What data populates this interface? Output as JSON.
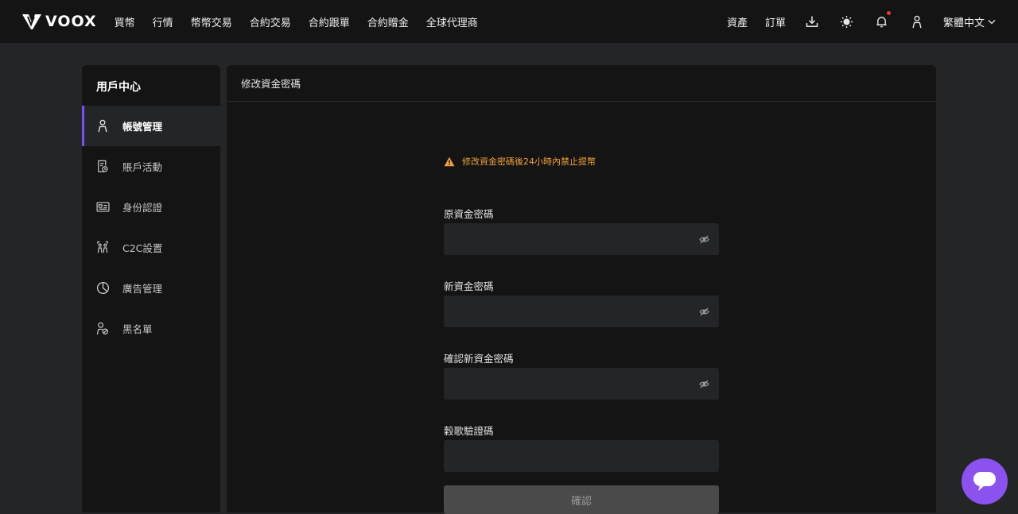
{
  "brand": {
    "name": "VOOX"
  },
  "nav": {
    "items": [
      "買幣",
      "行情",
      "幣幣交易",
      "合約交易",
      "合約跟單",
      "合約贈金",
      "全球代理商"
    ]
  },
  "header_right": {
    "assets": "資產",
    "orders": "訂單",
    "icons": [
      "download-icon",
      "theme-sun-icon",
      "bell-icon",
      "user-icon"
    ],
    "language": "繁體中文"
  },
  "sidebar": {
    "title": "用戶中心",
    "items": [
      {
        "label": "帳號管理",
        "icon": "user-icon",
        "active": true
      },
      {
        "label": "賬戶活動",
        "icon": "activity-icon",
        "active": false
      },
      {
        "label": "身份認證",
        "icon": "id-card-icon",
        "active": false
      },
      {
        "label": "C2C設置",
        "icon": "c2c-icon",
        "active": false
      },
      {
        "label": "廣告管理",
        "icon": "pie-chart-icon",
        "active": false
      },
      {
        "label": "黑名單",
        "icon": "blacklist-icon",
        "active": false
      }
    ]
  },
  "main": {
    "title": "修改資金密碼",
    "warning": "修改資金密碼後24小時內禁止提幣",
    "fields": [
      {
        "label": "原資金密碼",
        "value": "",
        "has_eye": true
      },
      {
        "label": "新資金密碼",
        "value": "",
        "has_eye": true
      },
      {
        "label": "確認新資金密碼",
        "value": "",
        "has_eye": true
      },
      {
        "label": "穀歌驗證碼",
        "value": "",
        "has_eye": false
      }
    ],
    "confirm": "確認"
  },
  "colors": {
    "accent": "#7c4dff",
    "warning": "#f0a23a",
    "chat": "#8c52f0",
    "notification_dot": "#e53935"
  }
}
